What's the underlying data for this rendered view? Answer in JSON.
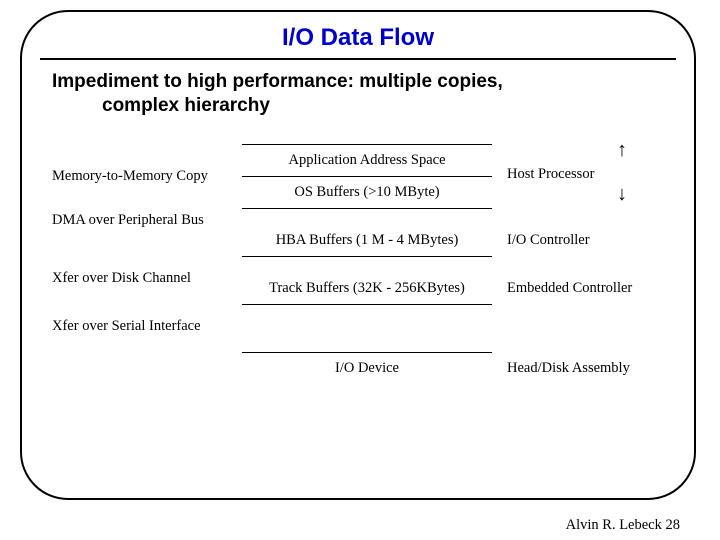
{
  "title": "I/O Data Flow",
  "subtitle_line1": "Impediment to high performance: multiple copies,",
  "subtitle_line2": "complex hierarchy",
  "left_labels": [
    "Memory-to-Memory Copy",
    "DMA over Peripheral Bus",
    "Xfer over Disk Channel",
    "Xfer over Serial Interface"
  ],
  "center_labels": [
    "Application Address Space",
    "OS Buffers (>10 MByte)",
    "HBA Buffers (1 M - 4 MBytes)",
    "Track Buffers (32K - 256KBytes)",
    "I/O Device"
  ],
  "right_labels": [
    "Host Processor",
    "I/O Controller",
    "Embedded Controller",
    "Head/Disk Assembly"
  ],
  "arrow_up": "↑",
  "arrow_down": "↓",
  "footer_author": "Alvin R. Lebeck ",
  "footer_page": "28"
}
